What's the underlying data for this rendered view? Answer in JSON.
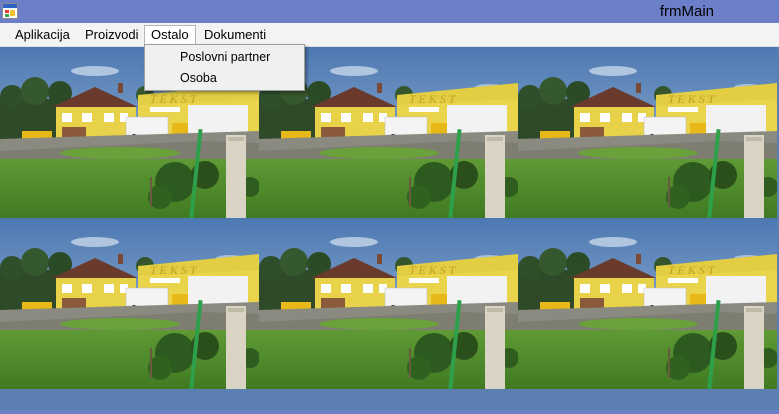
{
  "window": {
    "title": "frmMain",
    "icon": "app-window-icon"
  },
  "menu": {
    "items": [
      {
        "label": "Aplikacija"
      },
      {
        "label": "Proizvodi"
      },
      {
        "label": "Ostalo"
      },
      {
        "label": "Dokumenti"
      }
    ],
    "open_menu": "Ostalo",
    "dropdown_items": [
      {
        "label": "Poslovni partner"
      },
      {
        "label": "Osoba"
      }
    ]
  },
  "background": {
    "description_icon": "tiled-photo-background",
    "sign_text": "TEKST",
    "tiles": 6
  },
  "colors": {
    "titlebar": "#6b7ec7",
    "menubar": "#f3f3f3",
    "dropdown": "#f0f0f0",
    "sky": "#5a82b8",
    "grass": "#4f8a2a",
    "building_yellow": "#e8d34a"
  }
}
